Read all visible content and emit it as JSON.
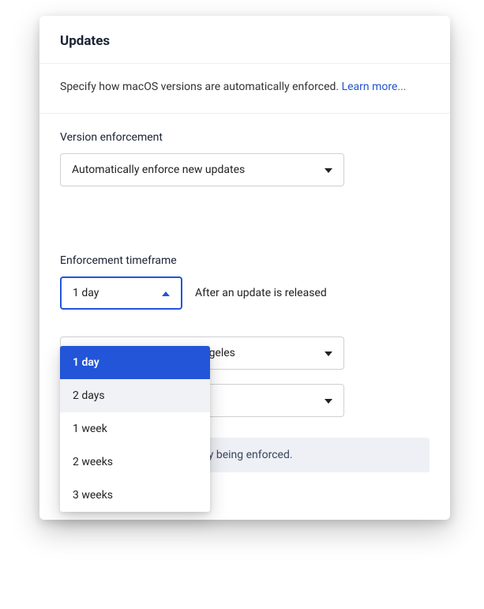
{
  "title": "Updates",
  "description_text": "Specify how macOS versions are automatically enforced. ",
  "learn_more": "Learn more...",
  "version_enforcement": {
    "label": "Version enforcement",
    "value": "Automatically enforce new updates"
  },
  "enforcement_timeframe": {
    "label": "Enforcement timeframe",
    "value": "1 day",
    "after_text": "After an update is released",
    "options": [
      "1 day",
      "2 days",
      "1 week",
      "2 weeks",
      "3 weeks"
    ]
  },
  "timezone": {
    "value_suffix": "ime - Los Angeles"
  },
  "banner_suffix": "urrently being enforced."
}
